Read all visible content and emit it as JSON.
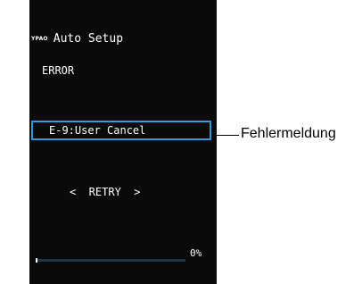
{
  "header": {
    "logo_text": "YPAO",
    "title": "Auto Setup"
  },
  "status": {
    "label": "ERROR",
    "message": "E-9:User Cancel"
  },
  "action": {
    "retry_text": "<  RETRY  >"
  },
  "progress": {
    "value_fraction": 0.0,
    "text": "0%"
  },
  "callout": {
    "label": "Fehlermeldung"
  },
  "colors": {
    "screen_background": "#0a0a0a",
    "highlight_border": "#2e9ad8",
    "progress_track": "#1d3646",
    "text": "#ffffff"
  }
}
